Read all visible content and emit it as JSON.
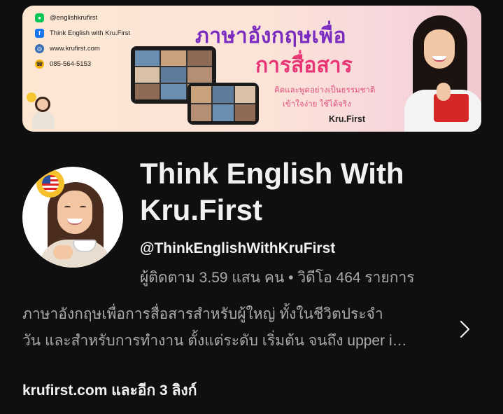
{
  "banner": {
    "contacts": [
      {
        "icon": "line-icon",
        "text": "@englishkrufirst"
      },
      {
        "icon": "facebook-icon",
        "text": "Think English with Kru.First"
      },
      {
        "icon": "globe-icon",
        "text": "www.krufirst.com"
      },
      {
        "icon": "phone-icon",
        "text": "085-564-5153"
      }
    ],
    "title_line1": "ภาษาอังกฤษเพื่อ",
    "title_line2": "การสื่อสาร",
    "tagline1": "คิดและพูดอย่างเป็นธรรมชาติ",
    "tagline2": "เข้าใจง่าย ใช้ได้จริง",
    "signature": "Kru.First"
  },
  "channel": {
    "name": "Think English With Kru.First",
    "handle": "@ThinkEnglishWithKruFirst",
    "stats": "ผู้ติดตาม 3.59 แสน คน • วิดีโอ 464 รายการ",
    "description_line1": "ภาษาอังกฤษเพื่อการสื่อสารสำหรับผู้ใหญ่ ทั้งในชีวิตประจำ",
    "description_line2": "วัน และสำหรับการทำงาน ตั้งแต่ระดับ เริ่มต้น จนถึง upper i…",
    "link_primary": "krufirst.com",
    "link_more": " และอีก 3 ลิงก์"
  },
  "colors": {
    "background": "#0f0f0f",
    "text_primary": "#f1f1f1",
    "text_secondary": "#aaaaaa",
    "banner_title_purple": "#7a2cc0",
    "banner_title_pink": "#e83375"
  }
}
